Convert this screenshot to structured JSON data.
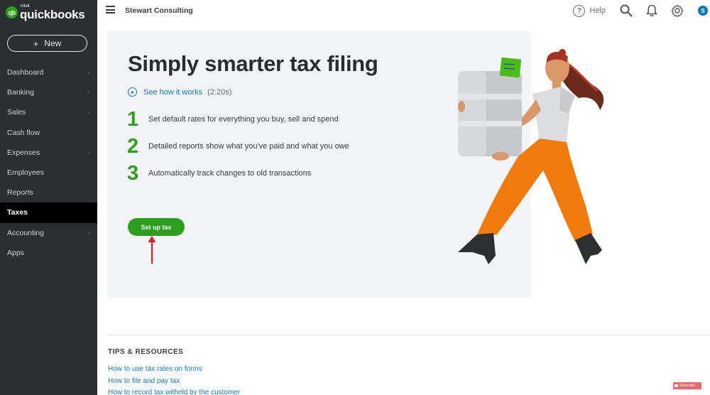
{
  "sidebar": {
    "logo": {
      "brand_small": "intuit",
      "brand": "quickbooks",
      "badge": "qb"
    },
    "new_button": {
      "icon": "plus-icon",
      "label": "New"
    },
    "items": [
      {
        "label": "Dashboard",
        "has_submenu": true,
        "active": false
      },
      {
        "label": "Banking",
        "has_submenu": true,
        "active": false
      },
      {
        "label": "Sales",
        "has_submenu": true,
        "active": false
      },
      {
        "label": "Cash flow",
        "has_submenu": false,
        "active": false
      },
      {
        "label": "Expenses",
        "has_submenu": true,
        "active": false
      },
      {
        "label": "Employees",
        "has_submenu": false,
        "active": false
      },
      {
        "label": "Reports",
        "has_submenu": false,
        "active": false
      },
      {
        "label": "Taxes",
        "has_submenu": false,
        "active": true
      },
      {
        "label": "Accounting",
        "has_submenu": true,
        "active": false
      },
      {
        "label": "Apps",
        "has_submenu": false,
        "active": false
      }
    ],
    "chevron": "›"
  },
  "topbar": {
    "company": "Stewart Consulting",
    "help_label": "Help",
    "help_glyph": "?",
    "icons": [
      "search-icon",
      "bell-icon",
      "gear-icon"
    ],
    "avatar_initial": "S",
    "accent_color": "#0077c5"
  },
  "hero": {
    "title": "Simply smarter tax filing",
    "video_link": "See how it works",
    "video_duration": "(2:20s)",
    "steps": [
      {
        "number": "1",
        "text": "Set default rates for everything you buy, sell and spend"
      },
      {
        "number": "2",
        "text": "Detailed reports show what you've paid and what you owe"
      },
      {
        "number": "3",
        "text": "Automatically track changes to old transactions"
      }
    ],
    "cta_label": "Set up tax",
    "brand_green": "#2ca01c"
  },
  "tips": {
    "title": "TIPS & RESOURCES",
    "links": [
      "How to use tax rates on forms",
      "How to file and pay tax",
      "How to record tax witheld by the customer"
    ]
  },
  "overlay": {
    "subscribe_label": "Subscribe"
  }
}
